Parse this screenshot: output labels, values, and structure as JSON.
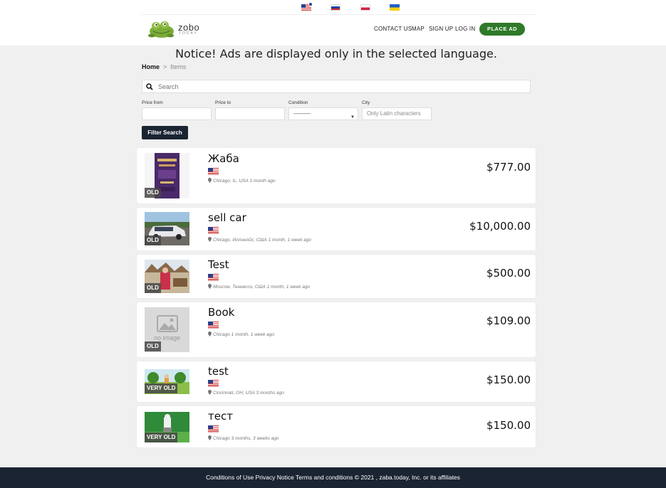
{
  "header": {
    "languages": [
      "en",
      "ru",
      "pl",
      "uk"
    ],
    "logo": {
      "name": "zobo",
      "tagline": "TODAY"
    },
    "nav": {
      "contact": "CONTACT US",
      "map": "MAP",
      "signup": "SIGN UP",
      "login": "LOG IN"
    },
    "place_ad": "PLACE AD"
  },
  "notice": "Notice! Ads are displayed only in the selected language.",
  "breadcrumb": {
    "home": "Home",
    "sep": ">",
    "current": "Items"
  },
  "search": {
    "placeholder": "Search"
  },
  "filters": {
    "price_from_label": "Price from",
    "price_to_label": "Price to",
    "condition_label": "Condition",
    "condition_value": "---------",
    "city_label": "City",
    "city_placeholder": "Only Latin characters",
    "button": "Filter Search"
  },
  "listings": [
    {
      "title": "Жаба",
      "badge": "OLD",
      "location": "Chicago, IL, USA",
      "age": "1 month ago",
      "price": "$777.00",
      "image": "book-cover"
    },
    {
      "title": "sell car",
      "badge": "OLD",
      "location": "Chicago, Иллинойс, США",
      "age": "1 month, 1 week ago",
      "price": "$10,000.00",
      "image": "car-photo"
    },
    {
      "title": "Test",
      "badge": "OLD",
      "location": "Moscow, Теннесси, США",
      "age": "1 month, 1 week ago",
      "price": "$500.00",
      "image": "outdoor-photo"
    },
    {
      "title": "Book",
      "badge": "OLD",
      "location": "Chicago",
      "age": "1 month, 1 week ago",
      "price": "$109.00",
      "image": "no-image",
      "no_image_text": "no image"
    },
    {
      "title": "test",
      "badge": "VERY OLD",
      "location": "Cincinnati, OH, USA",
      "age": "3 months ago",
      "price": "$150.00",
      "image": "cartoon-park"
    },
    {
      "title": "тест",
      "badge": "VERY OLD",
      "location": "Chicago",
      "age": "3 months, 3 weeks ago",
      "price": "$150.00",
      "image": "cartoon-green"
    }
  ],
  "footer": "Conditions of Use Privacy Notice Terms and conditions © 2021 , zaba.today, Inc. or its affiliates",
  "colors": {
    "accent_green": "#2f7a2a",
    "navy": "#1a2432",
    "background": "#f0f0f0"
  }
}
